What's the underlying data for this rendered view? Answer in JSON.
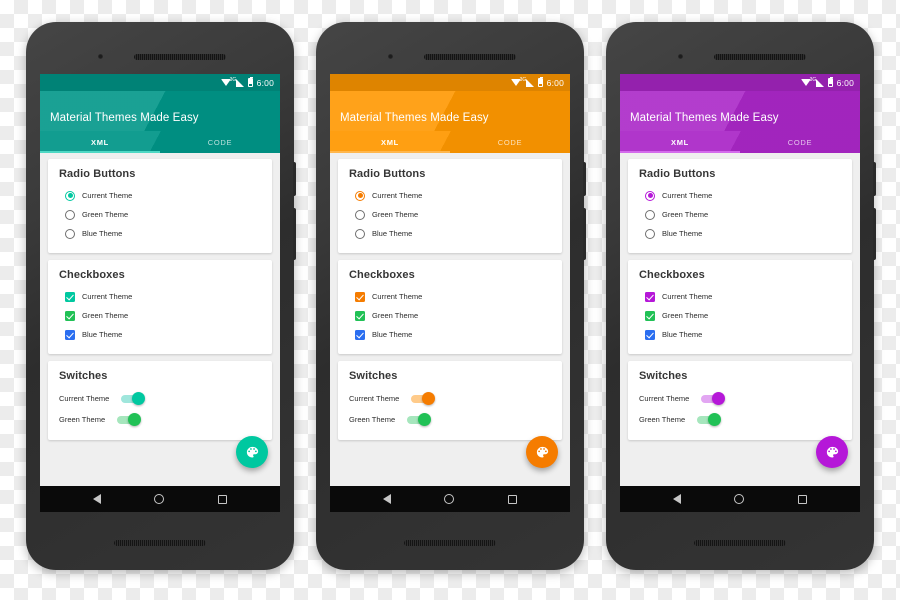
{
  "status_bar": {
    "time": "6:00",
    "network_label": "3G",
    "icons": [
      "wifi-icon",
      "signal-icon",
      "battery-icon"
    ]
  },
  "app": {
    "title": "Material Themes Made Easy",
    "tabs": [
      {
        "label": "XML",
        "active": true
      },
      {
        "label": "CODE",
        "active": false
      }
    ]
  },
  "cards": {
    "radio": {
      "title": "Radio Buttons",
      "options": [
        {
          "label": "Current Theme",
          "checked": true
        },
        {
          "label": "Green Theme",
          "checked": false
        },
        {
          "label": "Blue Theme",
          "checked": false
        }
      ]
    },
    "checkbox": {
      "title": "Checkboxes",
      "options": [
        {
          "label": "Current Theme",
          "checked": true,
          "color": "accent"
        },
        {
          "label": "Green Theme",
          "checked": true,
          "color": "#21c156"
        },
        {
          "label": "Blue Theme",
          "checked": true,
          "color": "#2a6ef0"
        }
      ]
    },
    "switch": {
      "title": "Switches",
      "options": [
        {
          "label": "Current Theme",
          "on": true,
          "color": "accent"
        },
        {
          "label": "Green Theme",
          "on": true,
          "color": "#21c156"
        }
      ]
    }
  },
  "fab": {
    "icon": "palette-icon"
  },
  "nav_bar": {
    "items": [
      {
        "name": "back-button"
      },
      {
        "name": "home-button"
      },
      {
        "name": "recents-button"
      }
    ]
  },
  "phones": [
    {
      "name": "teal-theme-phone",
      "theme_name": "Teal",
      "primary": "#009688",
      "primary_dark": "#00796b",
      "accent": "#00c8a0",
      "indicator": "#4fd8c4",
      "switch_track": "#9fe6dc"
    },
    {
      "name": "orange-theme-phone",
      "theme_name": "Orange",
      "primary": "#ff9800",
      "primary_dark": "#f57c00",
      "accent": "#f57c00",
      "indicator": "#ffb74d",
      "switch_track": "#ffcb8a"
    },
    {
      "name": "purple-theme-phone",
      "theme_name": "Purple",
      "primary": "#aa27c7",
      "primary_dark": "#9317b0",
      "accent": "#b517d8",
      "indicator": "#d46bec",
      "switch_track": "#e2a6f2"
    }
  ]
}
